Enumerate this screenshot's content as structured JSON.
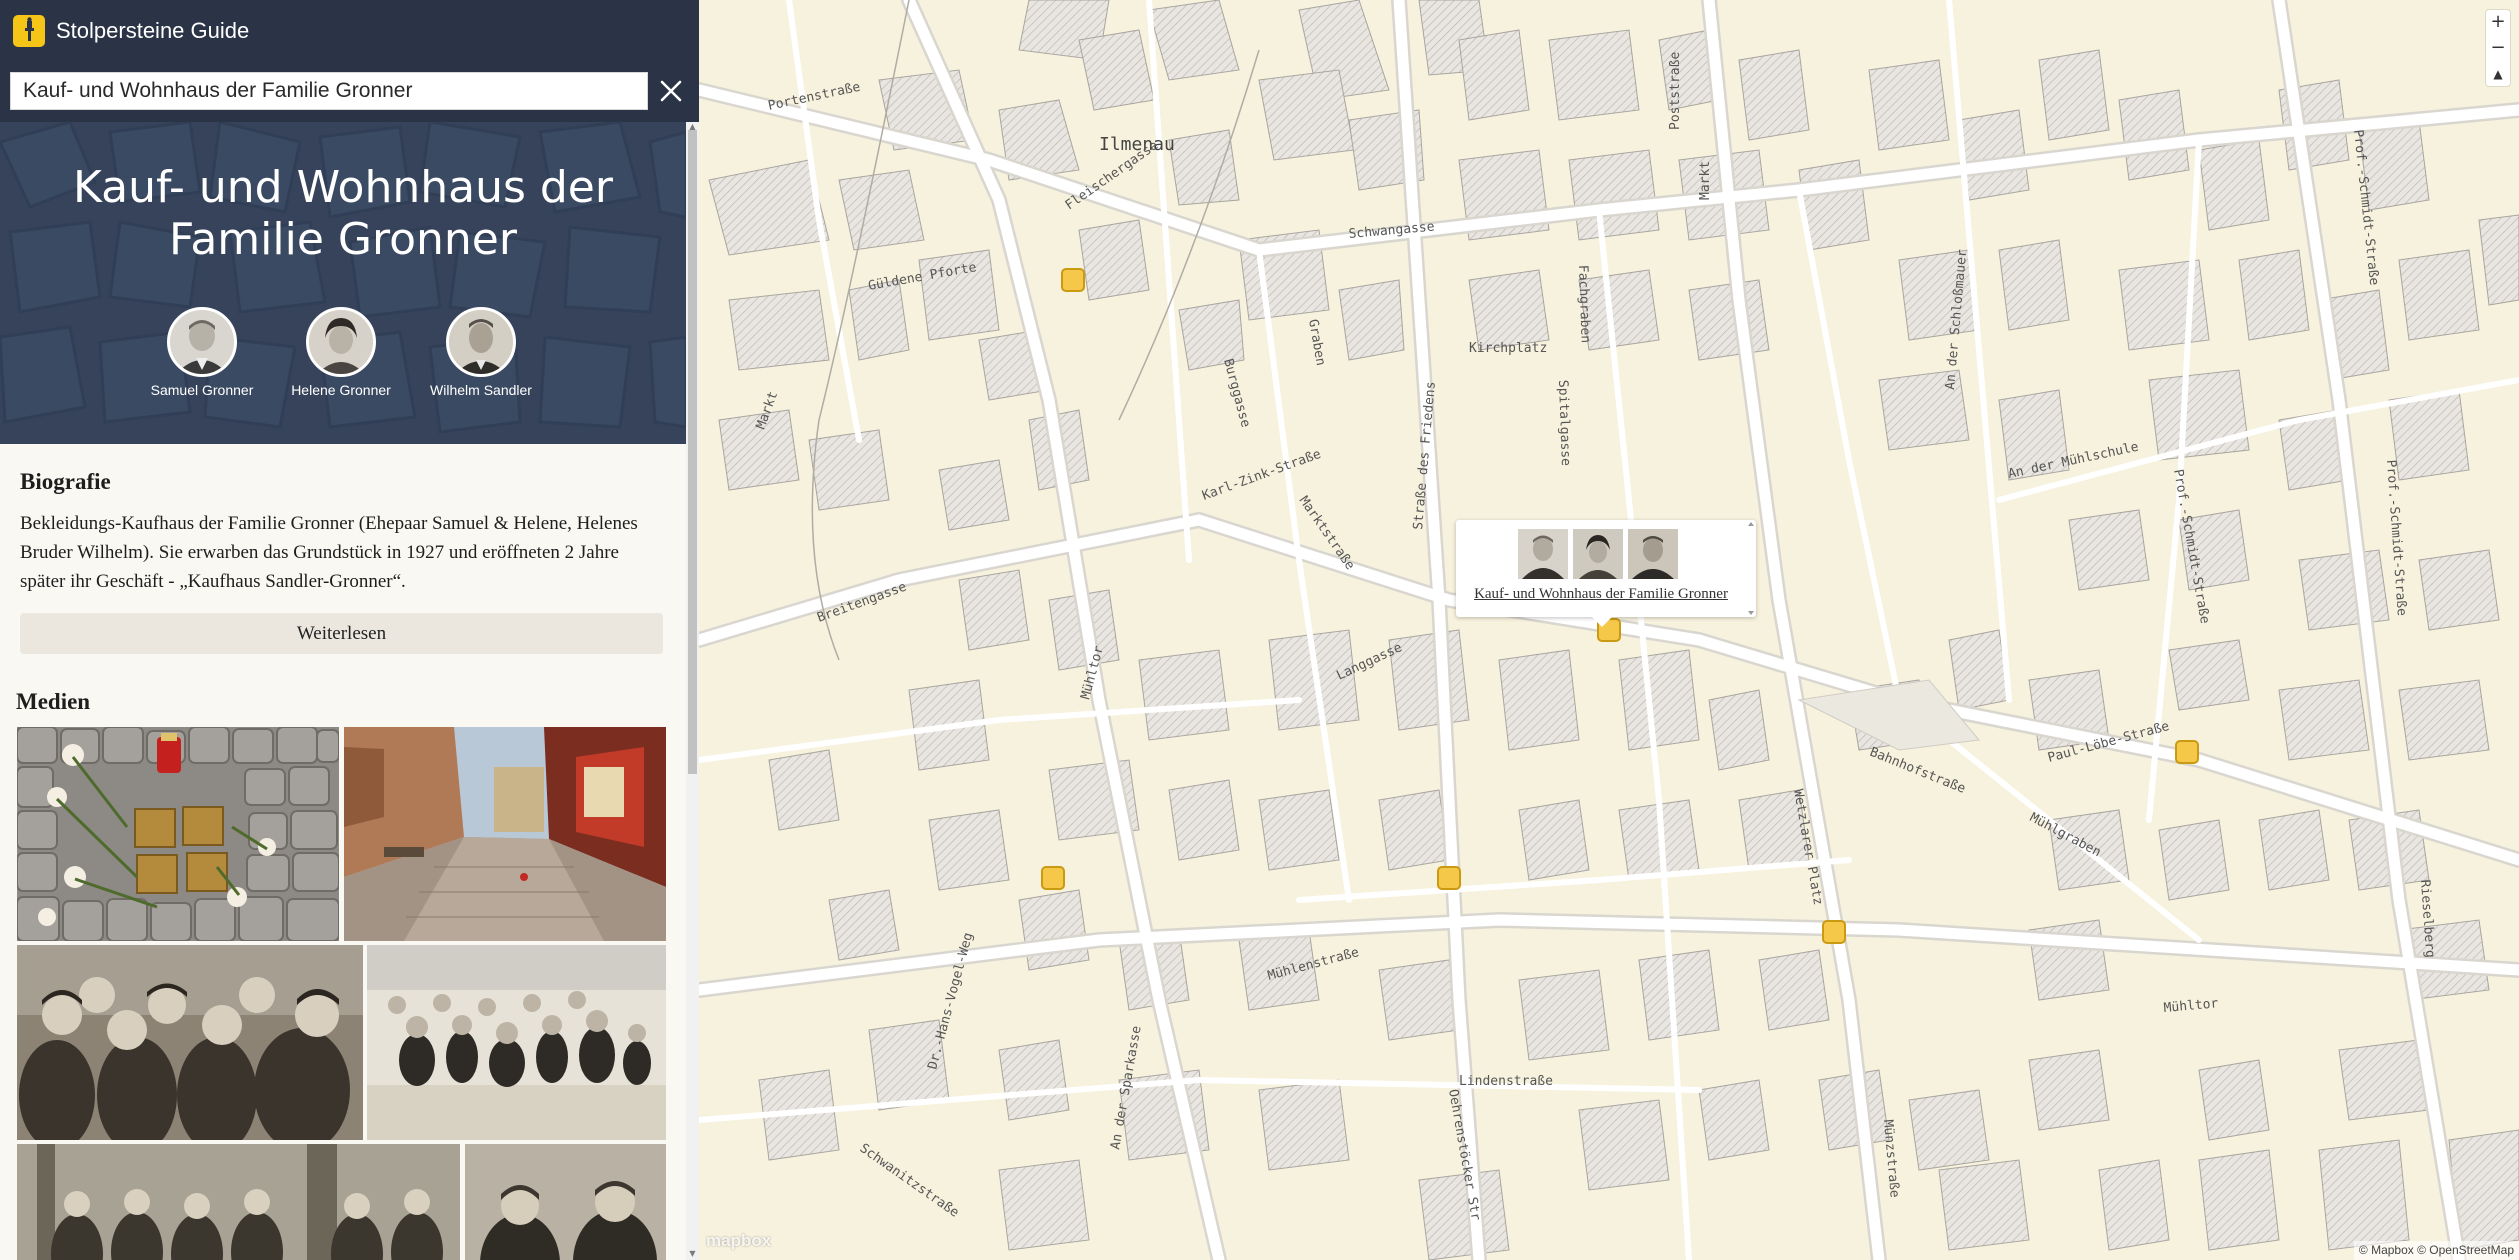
{
  "app": {
    "title": "Stolpersteine Guide"
  },
  "search": {
    "value": "Kauf- und Wohnhaus der Familie Gronner",
    "clear_icon": "close-icon"
  },
  "hero": {
    "title": "Kauf- und Wohnhaus der Familie Gronner",
    "persons": [
      {
        "name": "Samuel Gronner"
      },
      {
        "name": "Helene Gronner"
      },
      {
        "name": "Wilhelm Sandler"
      }
    ]
  },
  "biografie": {
    "heading": "Biografie",
    "text": "Bekleidungs-Kaufhaus der Familie Gronner (Ehepaar Samuel & Helene, Helenes Bruder Wilhelm). Sie erwarben das Grundstück in 1927 und eröffneten 2 Jahre später ihr Geschäft - „Kaufhaus Sandler-Gronner“.",
    "read_more": "Weiterlesen"
  },
  "media": {
    "heading": "Medien"
  },
  "map": {
    "labels": {
      "town": "Ilmenau",
      "streets": [
        "Portenstraße",
        "Fleischergasse",
        "Güldene Pforte",
        "Schwangasse",
        "Kirchplatz",
        "Poststraße",
        "Fachgraben",
        "Spitalgasse",
        "Burggasse",
        "Graben",
        "Karl-Zink-Straße",
        "Breitengasse",
        "Marktstraße",
        "Straße des Friedens",
        "Langgasse",
        "Mühltor",
        "Wetzlarer Platz",
        "Bahnhofstraße",
        "Paul-Löbe-Straße",
        "Mühlgraben",
        "Mühlenstraße",
        "Lindenstraße",
        "Dr.-Hans-Vogel-Weg",
        "An der Sparkasse",
        "Schwanitzstraße",
        "Oehrenstöcker Str",
        "Münzstraße",
        "An der Schloßmauer",
        "An der Mühlschule",
        "Prof.-Schmidt-Straße",
        "Prof.-Schmidt-Straße",
        "Prof.-Schmidt-Straße",
        "Rieselberg",
        "Markt"
      ]
    },
    "popup": {
      "link_text": "Kauf- und Wohnhaus der Familie Gronner"
    },
    "zoom": {
      "in": "+",
      "out": "−",
      "compass": "▲"
    },
    "logo": "mapbox",
    "attribution": "© Mapbox © OpenStreetMap"
  }
}
